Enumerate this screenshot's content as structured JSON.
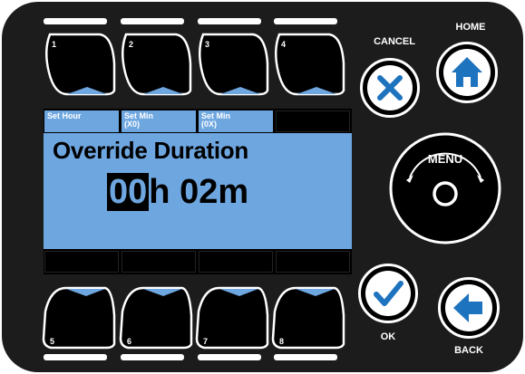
{
  "soft_keys": {
    "top": [
      {
        "number": "1"
      },
      {
        "number": "2"
      },
      {
        "number": "3"
      },
      {
        "number": "4"
      }
    ],
    "bottom": [
      {
        "number": "5"
      },
      {
        "number": "6"
      },
      {
        "number": "7"
      },
      {
        "number": "8"
      }
    ]
  },
  "lcd": {
    "softkey_labels": [
      {
        "line1": "Set Hour",
        "line2": ""
      },
      {
        "line1": "Set Min",
        "line2": "(X0)"
      },
      {
        "line1": "Set Min",
        "line2": "(0X)"
      },
      {
        "line1": "",
        "line2": ""
      }
    ],
    "title": "Override Duration",
    "hours_digits": "00",
    "hours_unit": "h",
    "minutes": "02m"
  },
  "buttons": {
    "cancel_label": "CANCEL",
    "home_label": "HOME",
    "menu_label": "MENU",
    "ok_label": "OK",
    "back_label": "BACK"
  },
  "colors": {
    "panel": "#1c1c1c",
    "lcd_backlight": "#6ea6e0",
    "key_indicator": "#6ea6e0",
    "button_icon": "#1e73be"
  }
}
